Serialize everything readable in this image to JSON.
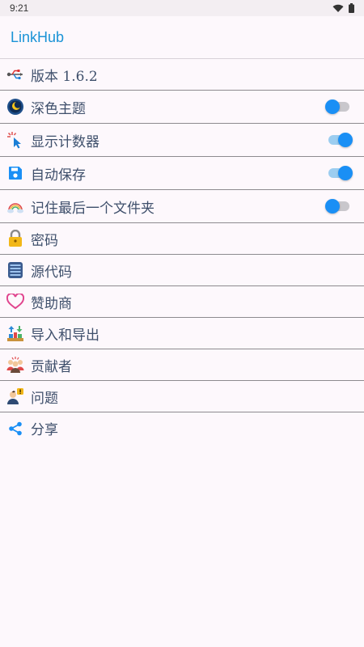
{
  "status_bar": {
    "time": "9:21"
  },
  "app_bar": {
    "title": "LinkHub"
  },
  "items": [
    {
      "label": "版本 1.6.2",
      "icon": "usb-version-icon"
    },
    {
      "label": "深色主题",
      "icon": "dark-theme-icon",
      "toggle": "off"
    },
    {
      "label": "显示计数器",
      "icon": "cursor-click-icon",
      "toggle": "on"
    },
    {
      "label": "自动保存",
      "icon": "save-icon",
      "toggle": "on"
    },
    {
      "label": "记住最后一个文件夹",
      "icon": "rainbow-cloud-icon",
      "toggle": "off"
    },
    {
      "label": "密码",
      "icon": "lock-icon"
    },
    {
      "label": "源代码",
      "icon": "source-code-icon"
    },
    {
      "label": "赞助商",
      "icon": "heart-icon"
    },
    {
      "label": "导入和导出",
      "icon": "import-export-icon"
    },
    {
      "label": "贡献者",
      "icon": "contributors-icon"
    },
    {
      "label": "问题",
      "icon": "issues-icon"
    },
    {
      "label": "分享",
      "icon": "share-icon"
    }
  ],
  "colors": {
    "accent": "#1a93d6",
    "toggle_knob": "#1a8ff5",
    "label": "#3e4f6b"
  }
}
